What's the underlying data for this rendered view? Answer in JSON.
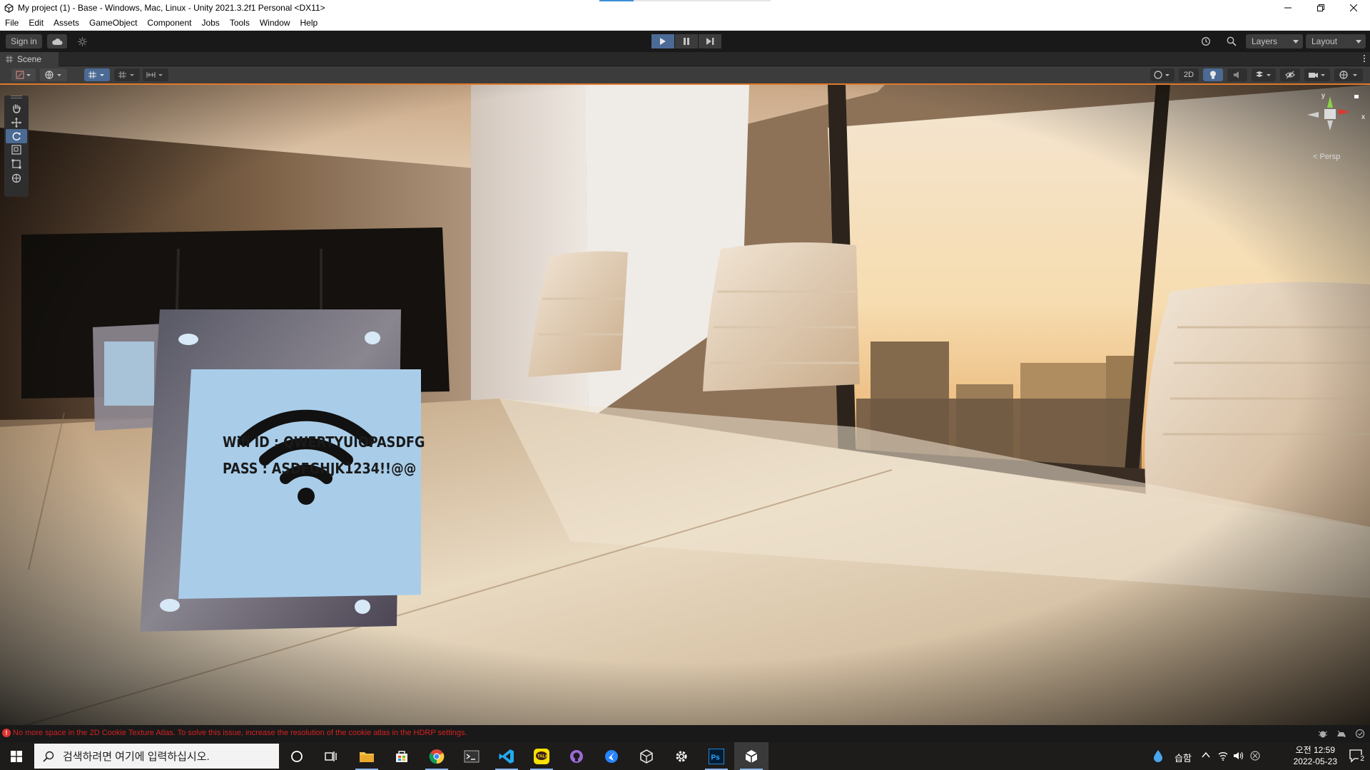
{
  "window": {
    "title": "My project (1) - Base - Windows, Mac, Linux - Unity 2021.3.2f1 Personal <DX11>",
    "minimize_icon": "minimize-icon",
    "maximize_icon": "restore-icon",
    "close_icon": "close-icon"
  },
  "menu": {
    "items": [
      "File",
      "Edit",
      "Assets",
      "GameObject",
      "Component",
      "Jobs",
      "Tools",
      "Window",
      "Help"
    ]
  },
  "toolbar": {
    "sign_in": "Sign in",
    "layers": "Layers",
    "layout": "Layout",
    "play_state": "playing"
  },
  "scene": {
    "tab_label": "Scene",
    "view_2d_label": "2D",
    "projection": "< Persp",
    "gizmo_axes": {
      "y": "y",
      "x": "x"
    },
    "sign": {
      "wifi_id": "Wifi ID : QWERTYUIOPASDFG",
      "password": "PASS : ASDFGHJK1234!!@@"
    }
  },
  "console": {
    "message": "No more space in the 2D Cookie Texture Atlas. To solve this issue, increase the resolution of the cookie atlas in the HDRP settings.",
    "error_color": "#d32222"
  },
  "taskbar": {
    "search_placeholder": "검색하려면 여기에 입력하십시오.",
    "weather_text": "습함",
    "time": "오전 12:59",
    "date": "2022-05-23",
    "notification_count": "2",
    "apps": [
      "cortana",
      "task-view",
      "file-explorer",
      "microsoft-store",
      "chrome",
      "terminal",
      "vscode",
      "kakaotalk",
      "github-desktop",
      "sourcetree",
      "unity-hub",
      "settings",
      "photoshop",
      "unity-editor"
    ]
  },
  "colors": {
    "accent_orange": "#e07a2b",
    "play_active": "#4c6a96",
    "editor_dark": "#191919"
  }
}
